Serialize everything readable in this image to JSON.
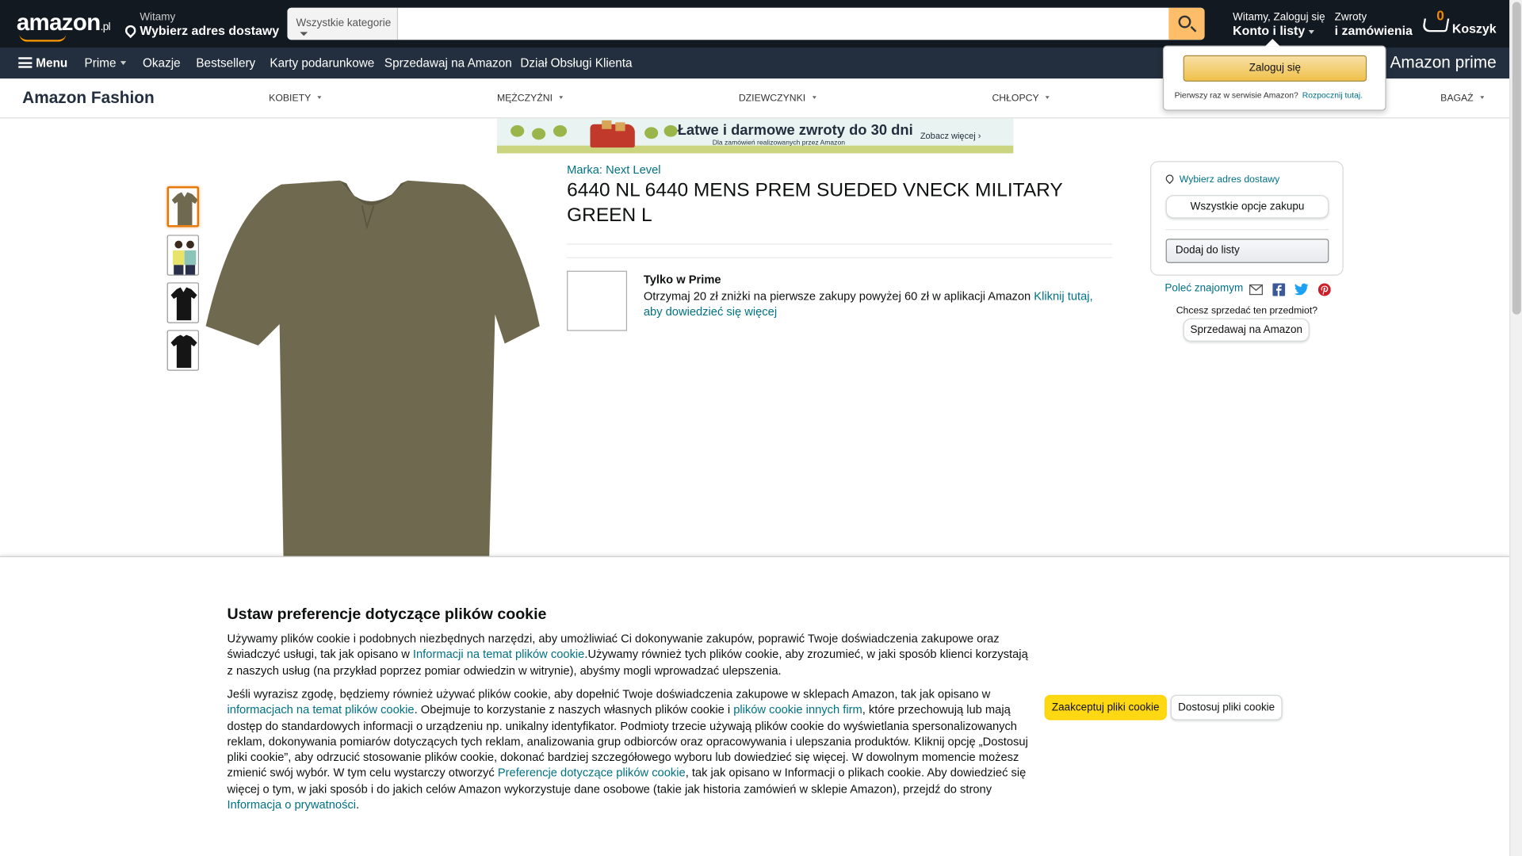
{
  "colors": {
    "nav_dark": "#131921",
    "nav_sub": "#232f3e",
    "accent_orange": "#ff9900",
    "search_button": "#febd69",
    "link": "#007185",
    "accept_yellow": "#ffd814",
    "shirt_green": "#6f6a4f"
  },
  "header": {
    "logo_text": "amazon",
    "logo_tld": ".pl",
    "deliver_line1": "Witamy",
    "deliver_line2": "Wybierz adres dostawy",
    "search_category": "Wszystkie kategorie",
    "search_value": "",
    "search_placeholder": "",
    "account_line1": "Witamy, Zaloguj się",
    "account_line2": "Konto i listy",
    "orders_line1": "Zwroty",
    "orders_line2": "i zamówienia",
    "cart_count": "0",
    "cart_label": "Koszyk"
  },
  "nav": {
    "menu_label": "Menu",
    "items": [
      "Prime",
      "Okazje",
      "Bestsellery",
      "Karty podarunkowe",
      "Sprzedawaj na Amazon",
      "Dział Obsługi Klienta"
    ],
    "prime_promo": "Amazon prime"
  },
  "signin_flyout": {
    "button": "Zaloguj się",
    "new_customer": "Pierwszy raz w serwisie Amazon?",
    "start_link": "Rozpocznij tutaj."
  },
  "fashion_nav": {
    "brand": "Amazon Fashion",
    "categories": [
      "KOBIETY",
      "MĘŻCZYŹNI",
      "DZIEWCZYNKI",
      "CHŁOPCY",
      "BAGAŻ"
    ]
  },
  "banner": {
    "headline": "Łatwe i darmowe zwroty do 30 dni",
    "subline": "Dla zamówień realizowanych przez Amazon",
    "cta": "Zobacz więcej ›"
  },
  "product": {
    "brand_link": "Marka: Next Level",
    "title": "6440 NL 6440 MENS PREM SUEDED VNECK MILITARY GREEN L",
    "promo_title": "Tylko w Prime",
    "promo_text": "Otrzymaj 20 zł zniżki na pierwsze zakupy powyżej 60 zł w aplikacji Amazon ",
    "promo_link": "Kliknij tutaj, aby dowiedzieć się więcej",
    "thumbnails": [
      "military-green-shirt",
      "model-photo",
      "black-shirt-front",
      "black-shirt-back"
    ]
  },
  "buybox": {
    "location_link": "Wybierz adres dostawy",
    "all_options": "Wszystkie opcje zakupu",
    "add_to_list": "Dodaj do listy",
    "share_label": "Poleć znajomym",
    "sell_question": "Chcesz sprzedać ten przedmiot?",
    "sell_button": "Sprzedawaj na Amazon"
  },
  "cookie": {
    "title": "Ustaw preferencje dotyczące plików cookie",
    "p1_a": "Używamy plików cookie i podobnych niezbędnych narzędzi, aby umożliwiać Ci dokonywanie zakupów, poprawić Twoje doświadczenia zakupowe oraz świadczyć usługi, tak jak opisano w ",
    "p1_link": "Informacji na temat plików cookie",
    "p1_b": ".Używamy również tych plików cookie, aby zrozumieć, w jaki sposób klienci korzystają z naszych usług (na przykład poprzez pomiar odwiedzin w witrynie), abyśmy mogli wprowadzać ulepszenia.",
    "p2_a": "Jeśli wyrazisz zgodę, będziemy również używać plików cookie, aby dopełnić Twoje doświadczenia zakupowe w sklepach Amazon, tak jak opisano w ",
    "p2_link1": "informacjach na temat plików cookie",
    "p2_b": ". Obejmuje to korzystanie z naszych własnych plików cookie i ",
    "p2_link2": "plików cookie innych firm",
    "p2_c": ", które przechowują lub mają dostęp do standardowych informacji o urządzeniu np. unikalny identyfikator. Podmioty trzecie używają plików cookie do wyświetlania spersonalizowanych reklam, dokonywania pomiarów dotyczących tych reklam, analizowania grup odbiorców oraz opracowywania i ulepszania produktów. Kliknij opcję „Dostosuj pliki cookie”, aby odrzucić stosowanie plików cookie, dokonać bardziej szczegółowego wyboru lub dowiedzieć się więcej. W dowolnym momencie możesz zmienić swój wybór. W tym celu wystarczy otworzyć ",
    "p2_link3": "Preferencje dotyczące plików cookie",
    "p2_d": ", tak jak opisano w Informacji o plikach cookie. Aby dowiedzieć się więcej o tym, w jaki sposób i do jakich celów Amazon wykorzystuje dane osobowe (takie jak historia zamówień w sklepie Amazon), przejdź do strony ",
    "p2_link4": "Informacja o prywatności",
    "p2_e": ".",
    "accept": "Zaakceptuj pliki cookie",
    "customize": "Dostosuj pliki cookie"
  }
}
